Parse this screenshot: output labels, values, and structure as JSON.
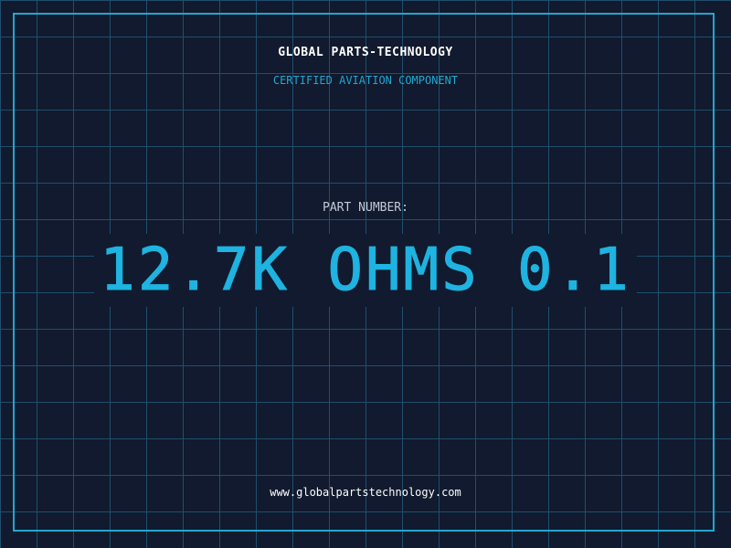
{
  "header": {
    "brand": "GLOBAL PARTS-TECHNOLOGY",
    "tagline": "CERTIFIED AVIATION COMPONENT"
  },
  "part": {
    "label": "PART NUMBER:",
    "value": "12.7K OHMS 0.1"
  },
  "footer": {
    "website": "www.globalpartstechnology.com"
  },
  "colors": {
    "background": "#111a2e",
    "grid": "#1f4f6e",
    "accent": "#22a7cf",
    "part_value": "#1eb3e0",
    "text": "#ffffff"
  }
}
